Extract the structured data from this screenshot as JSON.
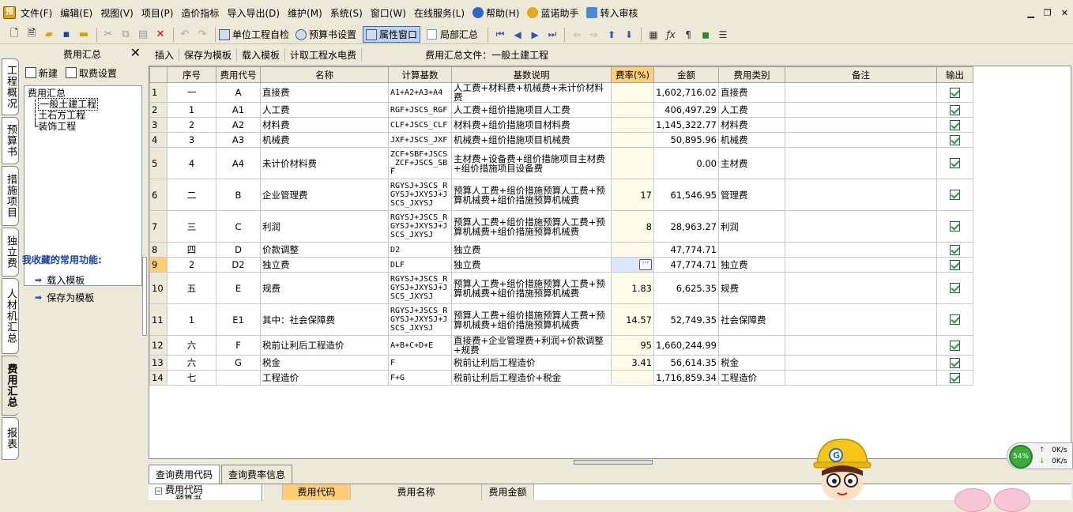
{
  "menu": {
    "items": [
      "文件(F)",
      "编辑(E)",
      "视图(V)",
      "项目(P)",
      "造价指标",
      "导入导出(D)",
      "维护(M)",
      "系统(S)",
      "窗口(W)",
      "在线服务(L)",
      "帮助(H)",
      "蓝诺助手",
      "转入审核"
    ]
  },
  "toolbar": {
    "unit_check": "单位工程自检",
    "budget_settings": "预算书设置",
    "property_window": "属性窗口",
    "local_summary": "局部汇总"
  },
  "vtabs": [
    "工程概况",
    "预算书",
    "措施项目",
    "独立费",
    "人材机汇总",
    "费用汇总",
    "报表"
  ],
  "left_panel": {
    "title": "费用汇总",
    "new_label": "新建",
    "fee_settings_label": "取费设置",
    "tree": {
      "root": "费用汇总",
      "children": [
        "一般土建工程",
        "土石方工程",
        "装饰工程"
      ]
    },
    "favorites_title": "我收藏的常用功能:",
    "favorites": [
      "载入模板",
      "保存为模板"
    ]
  },
  "sub_toolbar": {
    "insert": "插入",
    "save_template": "保存为模板",
    "load_template": "载入模板",
    "water_elec": "计取工程水电费",
    "file_label": "费用汇总文件：一般土建工程"
  },
  "grid": {
    "headers": [
      "序号",
      "费用代号",
      "名称",
      "计算基数",
      "基数说明",
      "费率(%)",
      "金额",
      "费用类别",
      "备注",
      "输出"
    ],
    "rows": [
      {
        "n": "1",
        "seq": "一",
        "code": "A",
        "name": "直接费",
        "base": "A1+A2+A3+A4",
        "desc": "人工费+材料费+机械费+未计价材料费",
        "rate": "",
        "amount": "1,602,716.02",
        "cat": "直接费",
        "note": ""
      },
      {
        "n": "2",
        "seq": "1",
        "code": "A1",
        "name": "人工费",
        "base": "RGF+JSCS_RGF",
        "desc": "人工费+组价措施项目人工费",
        "rate": "",
        "amount": "406,497.29",
        "cat": "人工费",
        "note": ""
      },
      {
        "n": "3",
        "seq": "2",
        "code": "A2",
        "name": "材料费",
        "base": "CLF+JSCS_CLF",
        "desc": "材料费+组价措施项目材料费",
        "rate": "",
        "amount": "1,145,322.77",
        "cat": "材料费",
        "note": ""
      },
      {
        "n": "4",
        "seq": "3",
        "code": "A3",
        "name": "机械费",
        "base": "JXF+JSCS_JXF",
        "desc": "机械费+组价措施项目机械费",
        "rate": "",
        "amount": "50,895.96",
        "cat": "机械费",
        "note": ""
      },
      {
        "n": "5",
        "seq": "4",
        "code": "A4",
        "name": "未计价材料费",
        "base": "ZCF+SBF+JSCS_ZCF+JSCS_SBF",
        "desc": "主材费+设备费+组价措施项目主材费+组价措施项目设备费",
        "rate": "",
        "amount": "0.00",
        "cat": "主材费",
        "note": ""
      },
      {
        "n": "6",
        "seq": "二",
        "code": "B",
        "name": "企业管理费",
        "base": "RGYSJ+JSCS_RGYSJ+JXYSJ+JSCS_JXYSJ",
        "desc": "预算人工费+组价措施预算人工费+预算机械费+组价措施预算机械费",
        "rate": "17",
        "amount": "61,546.95",
        "cat": "管理费",
        "note": ""
      },
      {
        "n": "7",
        "seq": "三",
        "code": "C",
        "name": "利润",
        "base": "RGYSJ+JSCS_RGYSJ+JXYSJ+JSCS_JXYSJ",
        "desc": "预算人工费+组价措施预算人工费+预算机械费+组价措施预算机械费",
        "rate": "8",
        "amount": "28,963.27",
        "cat": "利润",
        "note": ""
      },
      {
        "n": "8",
        "seq": "四",
        "code": "D",
        "name": "价款调整",
        "base": "D2",
        "desc": "独立费",
        "rate": "",
        "amount": "47,774.71",
        "cat": "",
        "note": ""
      },
      {
        "n": "9",
        "seq": "2",
        "code": "D2",
        "name": "独立费",
        "base": "DLF",
        "desc": "独立费",
        "rate": "···",
        "amount": "47,774.71",
        "cat": "独立费",
        "note": ""
      },
      {
        "n": "10",
        "seq": "五",
        "code": "E",
        "name": "规费",
        "base": "RGYSJ+JSCS_RGYSJ+JXYSJ+JSCS_JXYSJ",
        "desc": "预算人工费+组价措施预算人工费+预算机械费+组价措施预算机械费",
        "rate": "1.83",
        "amount": "6,625.35",
        "cat": "规费",
        "note": ""
      },
      {
        "n": "11",
        "seq": "1",
        "code": "E1",
        "name": "其中：社会保障费",
        "base": "RGYSJ+JSCS_RGYSJ+JXYSJ+JSCS_JXYSJ",
        "desc": "预算人工费+组价措施预算人工费+预算机械费+组价措施预算机械费",
        "rate": "14.57",
        "amount": "52,749.35",
        "cat": "社会保障费",
        "note": ""
      },
      {
        "n": "12",
        "seq": "六",
        "code": "F",
        "name": "税前让利后工程造价",
        "base": "A+B+C+D+E",
        "desc": "直接费+企业管理费+利润+价款调整+规费",
        "rate": "95",
        "amount": "1,660,244.99",
        "cat": "",
        "note": ""
      },
      {
        "n": "13",
        "seq": "六",
        "code": "G",
        "name": "税金",
        "base": "F",
        "desc": "税前让利后工程造价",
        "rate": "3.41",
        "amount": "56,614.35",
        "cat": "税金",
        "note": ""
      },
      {
        "n": "14",
        "seq": "七",
        "code": "",
        "name": "工程造价",
        "base": "F+G",
        "desc": "税前让利后工程造价+税金",
        "rate": "",
        "amount": "1,716,859.34",
        "cat": "工程造价",
        "note": ""
      }
    ]
  },
  "bottom": {
    "tabs": [
      "查询费用代码",
      "查询费率信息"
    ],
    "tree_root": "费用代码",
    "tree_child": "预算书",
    "headers": [
      "费用代码",
      "费用名称",
      "费用金额"
    ]
  },
  "speed": {
    "percent": "54%",
    "up": "0K/s",
    "down": "0K/s"
  }
}
